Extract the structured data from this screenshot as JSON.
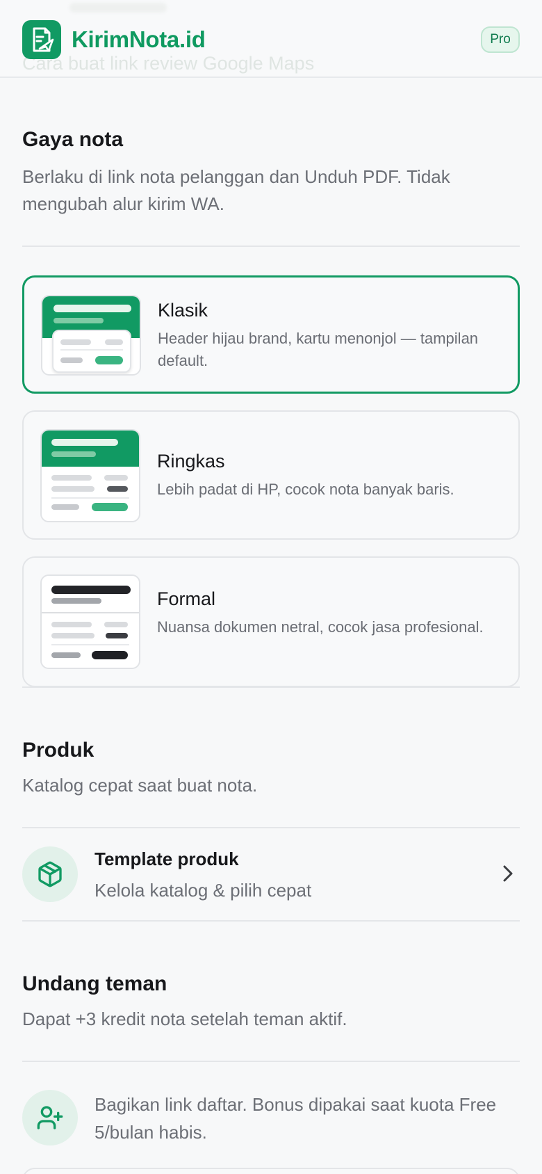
{
  "header": {
    "brand": "KirimNota.id",
    "badge": "Pro",
    "behind_text": "Cara buat link review Google Maps"
  },
  "style_section": {
    "title": "Gaya nota",
    "description": "Berlaku di link nota pelanggan dan Unduh PDF. Tidak mengubah alur kirim WA.",
    "selected": "Klasik",
    "options": [
      {
        "name": "Klasik",
        "description": "Header hijau brand, kartu menonjol — tampilan default."
      },
      {
        "name": "Ringkas",
        "description": "Lebih padat di HP, cocok nota banyak baris."
      },
      {
        "name": "Formal",
        "description": "Nuansa dokumen netral, cocok jasa profesional."
      }
    ]
  },
  "product_section": {
    "title": "Produk",
    "description": "Katalog cepat saat buat nota.",
    "row": {
      "icon": "package-icon",
      "title": "Template produk",
      "subtitle": "Kelola katalog & pilih cepat",
      "action_icon": "chevron-right-icon"
    }
  },
  "invite_section": {
    "title": "Undang teman",
    "description": "Dapat +3 kredit nota setelah teman aktif.",
    "row": {
      "icon": "user-plus-icon",
      "text": "Bagikan link daftar. Bonus dipakai saat kuota Free 5/bulan habis."
    }
  },
  "colors": {
    "brand_green": "#119a63",
    "light_green": "#e2f1ea",
    "text_primary": "#17181b",
    "text_secondary": "#6c6f76",
    "border": "#e3e5e8",
    "formal_dark": "#232428"
  }
}
